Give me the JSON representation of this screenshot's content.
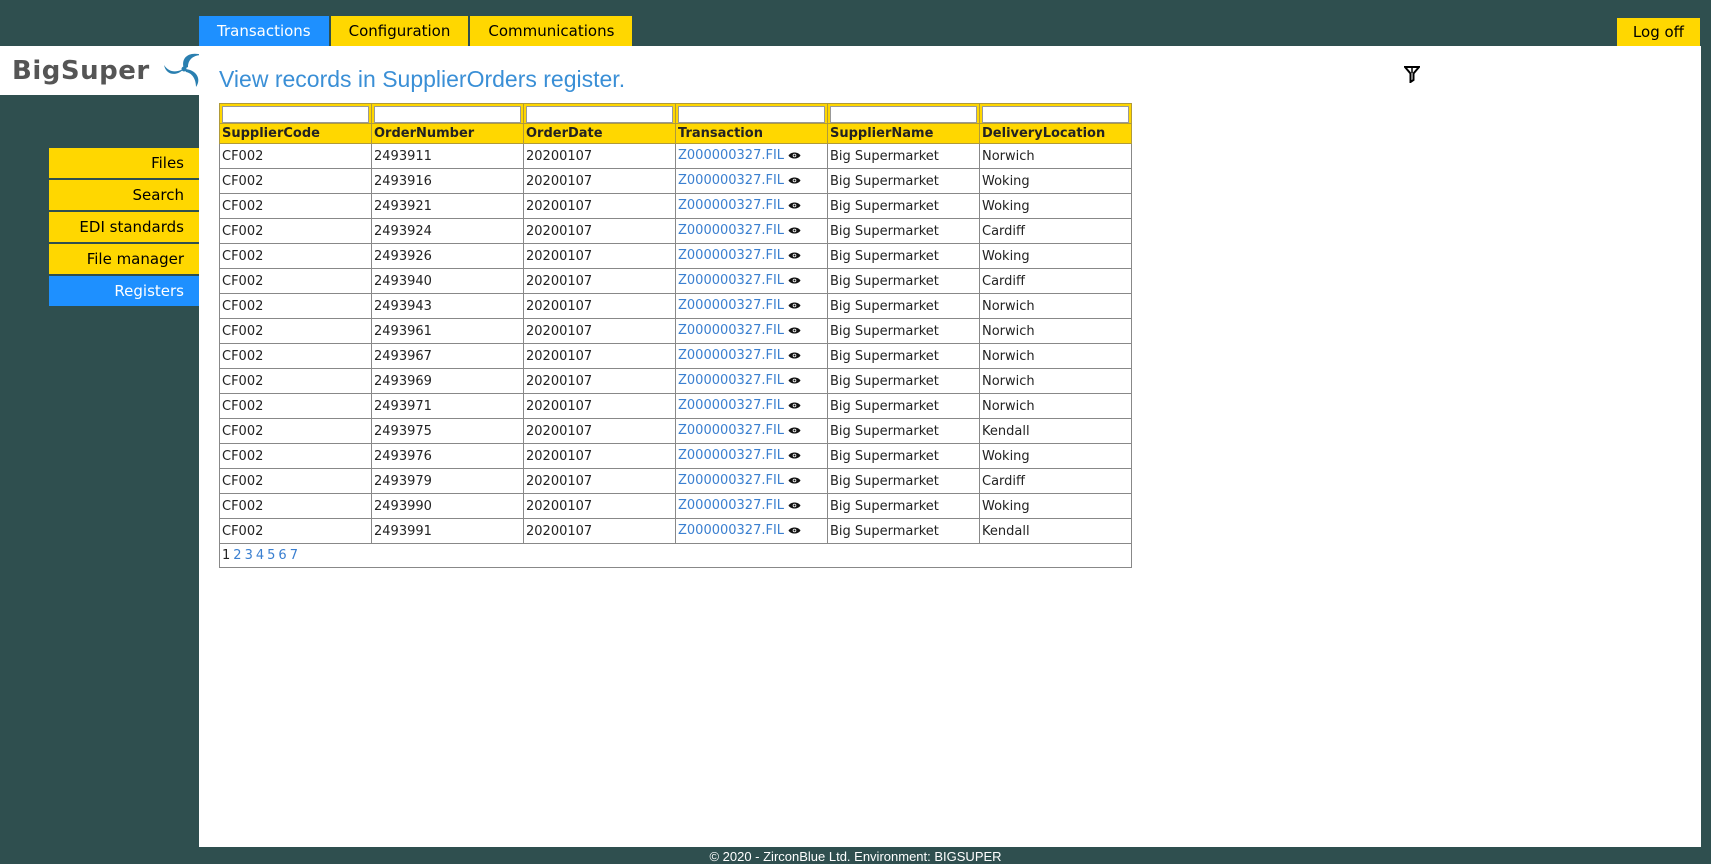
{
  "tabs": [
    {
      "label": "Transactions",
      "active": true
    },
    {
      "label": "Configuration",
      "active": false
    },
    {
      "label": "Communications",
      "active": false
    }
  ],
  "logoff_label": "Log off",
  "logo": {
    "text": "BigSuper",
    "icon": "bigsuper-logo-icon"
  },
  "sidebar": {
    "items": [
      {
        "label": "Files",
        "active": false
      },
      {
        "label": "Search",
        "active": false
      },
      {
        "label": "EDI standards",
        "active": false
      },
      {
        "label": "File manager",
        "active": false
      },
      {
        "label": "Registers",
        "active": true
      }
    ]
  },
  "main": {
    "title": "View records in SupplierOrders register.",
    "filter_icon": "filter-icon"
  },
  "table": {
    "columns": [
      "SupplierCode",
      "OrderNumber",
      "OrderDate",
      "Transaction",
      "SupplierName",
      "DeliveryLocation"
    ],
    "rows": [
      [
        "CF002",
        "2493911",
        "20200107",
        "Z000000327.FIL",
        "Big Supermarket",
        "Norwich"
      ],
      [
        "CF002",
        "2493916",
        "20200107",
        "Z000000327.FIL",
        "Big Supermarket",
        "Woking"
      ],
      [
        "CF002",
        "2493921",
        "20200107",
        "Z000000327.FIL",
        "Big Supermarket",
        "Woking"
      ],
      [
        "CF002",
        "2493924",
        "20200107",
        "Z000000327.FIL",
        "Big Supermarket",
        "Cardiff"
      ],
      [
        "CF002",
        "2493926",
        "20200107",
        "Z000000327.FIL",
        "Big Supermarket",
        "Woking"
      ],
      [
        "CF002",
        "2493940",
        "20200107",
        "Z000000327.FIL",
        "Big Supermarket",
        "Cardiff"
      ],
      [
        "CF002",
        "2493943",
        "20200107",
        "Z000000327.FIL",
        "Big Supermarket",
        "Norwich"
      ],
      [
        "CF002",
        "2493961",
        "20200107",
        "Z000000327.FIL",
        "Big Supermarket",
        "Norwich"
      ],
      [
        "CF002",
        "2493967",
        "20200107",
        "Z000000327.FIL",
        "Big Supermarket",
        "Norwich"
      ],
      [
        "CF002",
        "2493969",
        "20200107",
        "Z000000327.FIL",
        "Big Supermarket",
        "Norwich"
      ],
      [
        "CF002",
        "2493971",
        "20200107",
        "Z000000327.FIL",
        "Big Supermarket",
        "Norwich"
      ],
      [
        "CF002",
        "2493975",
        "20200107",
        "Z000000327.FIL",
        "Big Supermarket",
        "Kendall"
      ],
      [
        "CF002",
        "2493976",
        "20200107",
        "Z000000327.FIL",
        "Big Supermarket",
        "Woking"
      ],
      [
        "CF002",
        "2493979",
        "20200107",
        "Z000000327.FIL",
        "Big Supermarket",
        "Cardiff"
      ],
      [
        "CF002",
        "2493990",
        "20200107",
        "Z000000327.FIL",
        "Big Supermarket",
        "Woking"
      ],
      [
        "CF002",
        "2493991",
        "20200107",
        "Z000000327.FIL",
        "Big Supermarket",
        "Kendall"
      ]
    ],
    "pages": [
      "1",
      "2",
      "3",
      "4",
      "5",
      "6",
      "7"
    ],
    "current_page": "1",
    "view_icon": "eye-icon"
  },
  "footer": "© 2020 - ZirconBlue Ltd. Environment: BIGSUPER",
  "colors": {
    "background": "#2f4f4f",
    "accent_yellow": "#ffd700",
    "accent_blue": "#1e90ff",
    "link_blue": "#3a7fd0"
  }
}
